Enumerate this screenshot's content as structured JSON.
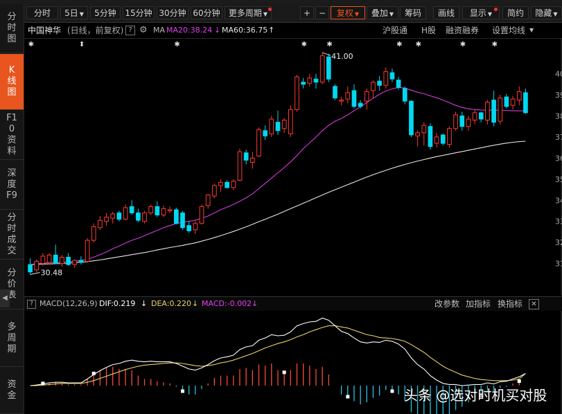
{
  "sidebar": {
    "items": [
      {
        "label": "分时图",
        "active": false
      },
      {
        "label": "K线图",
        "active": true
      },
      {
        "label": "F10资料",
        "active": false
      },
      {
        "label": "深度F9",
        "active": false
      },
      {
        "label": "分时成交",
        "active": false
      },
      {
        "label": "分价表",
        "active": false
      },
      {
        "label": "多周期",
        "active": false
      },
      {
        "label": "资金",
        "active": false
      }
    ]
  },
  "toolbar": {
    "periods": [
      "分时",
      "5日",
      "5分钟",
      "15分钟",
      "30分钟",
      "60分钟",
      "更多周期"
    ],
    "zoom_in": "+",
    "zoom_out": "−",
    "adjust": "复权",
    "overlay": "叠加",
    "chips": "筹码",
    "draw": "画线",
    "display": "显示",
    "simple": "简约",
    "hide": "隐藏"
  },
  "info": {
    "stock_name": "中国神华",
    "period_note": "(日线，前复权)",
    "help": "?",
    "ma_label": "MA",
    "ma20": "MA20:38.24",
    "ma60": "MA60:36.75",
    "links": [
      "沪股通",
      "H股",
      "融资融券",
      "设置均线"
    ]
  },
  "macd": {
    "title": "MACD(12,26,9)",
    "dif": "DIF:0.219",
    "dea": "DEA:0.220",
    "macd": "MACD:-0.002",
    "actions": [
      "改参数",
      "加指标",
      "换指标"
    ],
    "close": "✕"
  },
  "chart": {
    "price_high_label": "41.00",
    "price_low_label": "30.48",
    "right_axis": [
      "40",
      "39",
      "38",
      "37",
      "36",
      "35",
      "34",
      "33",
      "32",
      "31"
    ],
    "colors": {
      "up": "#ff3b30",
      "down": "#00d8f0",
      "ma20": "#d63be0",
      "ma60": "#e6e6e6",
      "dif": "#ffffff",
      "dea": "#e8d26a",
      "macd_pos": "#ff4a36",
      "macd_neg": "#22c8e8"
    }
  },
  "chart_data": {
    "type": "candlestick",
    "title": "中国神华",
    "ylabel": "",
    "ylim": [
      30.2,
      41.1
    ],
    "candles": [
      {
        "o": 30.95,
        "h": 31.25,
        "l": 30.48,
        "c": 30.6
      },
      {
        "o": 30.7,
        "h": 31.2,
        "l": 30.6,
        "c": 31.1
      },
      {
        "o": 31.0,
        "h": 31.5,
        "l": 30.9,
        "c": 31.35
      },
      {
        "o": 31.05,
        "h": 31.5,
        "l": 30.95,
        "c": 31.4
      },
      {
        "o": 31.4,
        "h": 31.9,
        "l": 31.3,
        "c": 31.0
      },
      {
        "o": 31.0,
        "h": 31.4,
        "l": 30.85,
        "c": 31.3
      },
      {
        "o": 31.3,
        "h": 31.5,
        "l": 30.9,
        "c": 30.95
      },
      {
        "o": 30.95,
        "h": 31.2,
        "l": 30.8,
        "c": 31.15
      },
      {
        "o": 31.15,
        "h": 31.35,
        "l": 30.95,
        "c": 31.05
      },
      {
        "o": 31.1,
        "h": 32.2,
        "l": 31.05,
        "c": 32.1
      },
      {
        "o": 32.1,
        "h": 32.9,
        "l": 32.0,
        "c": 32.75
      },
      {
        "o": 32.7,
        "h": 33.25,
        "l": 32.6,
        "c": 33.05
      },
      {
        "o": 33.0,
        "h": 33.4,
        "l": 32.8,
        "c": 33.2
      },
      {
        "o": 33.15,
        "h": 33.45,
        "l": 32.9,
        "c": 33.35
      },
      {
        "o": 33.4,
        "h": 33.5,
        "l": 33.0,
        "c": 33.1
      },
      {
        "o": 33.1,
        "h": 33.8,
        "l": 33.05,
        "c": 33.65
      },
      {
        "o": 33.7,
        "h": 34.0,
        "l": 33.3,
        "c": 33.4
      },
      {
        "o": 33.4,
        "h": 33.6,
        "l": 32.95,
        "c": 33.05
      },
      {
        "o": 33.0,
        "h": 33.5,
        "l": 32.9,
        "c": 33.4
      },
      {
        "o": 33.4,
        "h": 33.8,
        "l": 33.3,
        "c": 33.7
      },
      {
        "o": 33.7,
        "h": 33.95,
        "l": 33.2,
        "c": 33.3
      },
      {
        "o": 33.3,
        "h": 33.75,
        "l": 33.2,
        "c": 33.6
      },
      {
        "o": 33.5,
        "h": 33.7,
        "l": 33.4,
        "c": 33.55
      },
      {
        "o": 33.55,
        "h": 33.65,
        "l": 32.85,
        "c": 32.9
      },
      {
        "o": 33.4,
        "h": 33.5,
        "l": 32.6,
        "c": 32.7
      },
      {
        "o": 32.8,
        "h": 33.0,
        "l": 32.45,
        "c": 32.55
      },
      {
        "o": 32.6,
        "h": 33.0,
        "l": 32.4,
        "c": 32.9
      },
      {
        "o": 32.9,
        "h": 33.8,
        "l": 32.85,
        "c": 33.7
      },
      {
        "o": 33.75,
        "h": 34.3,
        "l": 33.6,
        "c": 34.25
      },
      {
        "o": 34.2,
        "h": 34.8,
        "l": 34.1,
        "c": 34.7
      },
      {
        "o": 34.7,
        "h": 35.0,
        "l": 34.4,
        "c": 34.85
      },
      {
        "o": 34.85,
        "h": 34.95,
        "l": 34.55,
        "c": 34.6
      },
      {
        "o": 34.6,
        "h": 35.0,
        "l": 34.5,
        "c": 34.9
      },
      {
        "o": 34.95,
        "h": 36.45,
        "l": 34.9,
        "c": 36.3
      },
      {
        "o": 36.25,
        "h": 36.4,
        "l": 35.7,
        "c": 35.9
      },
      {
        "o": 35.8,
        "h": 36.3,
        "l": 35.5,
        "c": 36.0
      },
      {
        "o": 36.1,
        "h": 37.45,
        "l": 36.05,
        "c": 37.35
      },
      {
        "o": 37.3,
        "h": 37.55,
        "l": 36.85,
        "c": 37.05
      },
      {
        "o": 37.15,
        "h": 38.0,
        "l": 37.0,
        "c": 37.85
      },
      {
        "o": 37.7,
        "h": 38.25,
        "l": 37.1,
        "c": 37.3
      },
      {
        "o": 37.4,
        "h": 37.9,
        "l": 37.2,
        "c": 37.8
      },
      {
        "o": 37.15,
        "h": 38.5,
        "l": 37.0,
        "c": 38.3
      },
      {
        "o": 38.3,
        "h": 39.95,
        "l": 38.2,
        "c": 39.85
      },
      {
        "o": 39.6,
        "h": 39.8,
        "l": 39.3,
        "c": 39.5
      },
      {
        "o": 39.55,
        "h": 40.0,
        "l": 39.4,
        "c": 39.8
      },
      {
        "o": 39.75,
        "h": 40.0,
        "l": 39.3,
        "c": 39.6
      },
      {
        "o": 39.6,
        "h": 41.0,
        "l": 39.5,
        "c": 40.85
      },
      {
        "o": 40.8,
        "h": 40.95,
        "l": 39.6,
        "c": 39.75
      },
      {
        "o": 39.4,
        "h": 39.5,
        "l": 38.75,
        "c": 38.85
      },
      {
        "o": 38.7,
        "h": 38.9,
        "l": 38.5,
        "c": 38.75
      },
      {
        "o": 38.8,
        "h": 39.4,
        "l": 38.6,
        "c": 39.1
      },
      {
        "o": 39.2,
        "h": 39.5,
        "l": 38.35,
        "c": 38.45
      },
      {
        "o": 38.6,
        "h": 38.75,
        "l": 38.35,
        "c": 38.45
      },
      {
        "o": 38.7,
        "h": 39.3,
        "l": 38.3,
        "c": 39.15
      },
      {
        "o": 39.2,
        "h": 39.7,
        "l": 38.85,
        "c": 39.6
      },
      {
        "o": 39.65,
        "h": 39.9,
        "l": 39.2,
        "c": 39.45
      },
      {
        "o": 39.45,
        "h": 40.3,
        "l": 39.3,
        "c": 40.1
      },
      {
        "o": 40.05,
        "h": 40.25,
        "l": 39.6,
        "c": 39.75
      },
      {
        "o": 39.7,
        "h": 39.85,
        "l": 39.25,
        "c": 39.35
      },
      {
        "o": 39.3,
        "h": 39.4,
        "l": 38.55,
        "c": 38.7
      },
      {
        "o": 38.7,
        "h": 38.75,
        "l": 37.0,
        "c": 37.1
      },
      {
        "o": 37.05,
        "h": 37.3,
        "l": 36.55,
        "c": 37.2
      },
      {
        "o": 37.2,
        "h": 37.7,
        "l": 36.6,
        "c": 37.55
      },
      {
        "o": 37.5,
        "h": 37.65,
        "l": 36.4,
        "c": 36.55
      },
      {
        "o": 36.7,
        "h": 37.2,
        "l": 36.5,
        "c": 37.0
      },
      {
        "o": 37.1,
        "h": 37.15,
        "l": 36.6,
        "c": 36.7
      },
      {
        "o": 36.65,
        "h": 37.5,
        "l": 36.5,
        "c": 37.4
      },
      {
        "o": 37.4,
        "h": 38.2,
        "l": 37.3,
        "c": 38.05
      },
      {
        "o": 38.0,
        "h": 38.2,
        "l": 37.3,
        "c": 37.5
      },
      {
        "o": 37.5,
        "h": 38.0,
        "l": 37.3,
        "c": 37.85
      },
      {
        "o": 37.8,
        "h": 38.3,
        "l": 37.6,
        "c": 38.15
      },
      {
        "o": 38.15,
        "h": 38.2,
        "l": 37.7,
        "c": 37.85
      },
      {
        "o": 37.8,
        "h": 38.75,
        "l": 37.6,
        "c": 38.65
      },
      {
        "o": 38.75,
        "h": 39.2,
        "l": 37.5,
        "c": 37.7
      },
      {
        "o": 37.75,
        "h": 39.0,
        "l": 37.6,
        "c": 38.85
      },
      {
        "o": 38.9,
        "h": 39.05,
        "l": 38.35,
        "c": 38.45
      },
      {
        "o": 38.5,
        "h": 38.95,
        "l": 38.3,
        "c": 38.8
      },
      {
        "o": 38.75,
        "h": 39.4,
        "l": 38.5,
        "c": 39.15
      },
      {
        "o": 39.1,
        "h": 39.3,
        "l": 38.1,
        "c": 38.15
      }
    ],
    "ma20": [
      30.95,
      31.0,
      31.0,
      31.05,
      31.05,
      31.05,
      31.1,
      31.1,
      31.15,
      31.2,
      31.3,
      31.42,
      31.55,
      31.7,
      31.83,
      31.97,
      32.1,
      32.2,
      32.32,
      32.45,
      32.57,
      32.7,
      32.8,
      32.9,
      32.95,
      33.0,
      33.05,
      33.15,
      33.25,
      33.4,
      33.55,
      33.67,
      33.8,
      33.95,
      34.12,
      34.3,
      34.55,
      34.8,
      35.05,
      35.3,
      35.55,
      35.82,
      36.12,
      36.45,
      36.72,
      37.0,
      37.3,
      37.55,
      37.75,
      37.88,
      38.05,
      38.25,
      38.43,
      38.63,
      38.83,
      39.03,
      39.18,
      39.28,
      39.35,
      39.32,
      39.22,
      39.12,
      39.05,
      38.95,
      38.86,
      38.75,
      38.63,
      38.5,
      38.4,
      38.34,
      38.3,
      38.28,
      38.27,
      38.27,
      38.27,
      38.26,
      38.24,
      38.24,
      38.24
    ],
    "ma60": [
      30.95,
      30.96,
      30.97,
      30.98,
      30.99,
      31.0,
      31.02,
      31.04,
      31.06,
      31.09,
      31.13,
      31.17,
      31.22,
      31.27,
      31.32,
      31.37,
      31.42,
      31.47,
      31.52,
      31.58,
      31.64,
      31.7,
      31.76,
      31.81,
      31.86,
      31.92,
      31.98,
      32.06,
      32.14,
      32.23,
      32.32,
      32.42,
      32.52,
      32.63,
      32.74,
      32.86,
      32.98,
      33.1,
      33.22,
      33.34,
      33.47,
      33.6,
      33.73,
      33.86,
      33.99,
      34.12,
      34.25,
      34.38,
      34.5,
      34.62,
      34.74,
      34.86,
      34.98,
      35.1,
      35.21,
      35.32,
      35.42,
      35.52,
      35.61,
      35.7,
      35.78,
      35.86,
      35.93,
      36.0,
      36.07,
      36.13,
      36.19,
      36.25,
      36.31,
      36.37,
      36.43,
      36.49,
      36.55,
      36.61,
      36.66,
      36.71,
      36.75,
      36.78,
      36.8
    ],
    "macd_dif": [
      0.0,
      0.01,
      0.03,
      0.05,
      0.06,
      0.06,
      0.05,
      0.05,
      0.05,
      0.12,
      0.2,
      0.27,
      0.33,
      0.38,
      0.4,
      0.44,
      0.46,
      0.44,
      0.43,
      0.44,
      0.43,
      0.43,
      0.43,
      0.4,
      0.35,
      0.3,
      0.28,
      0.32,
      0.38,
      0.45,
      0.5,
      0.52,
      0.55,
      0.65,
      0.7,
      0.72,
      0.82,
      0.86,
      0.92,
      0.9,
      0.91,
      0.97,
      1.08,
      1.12,
      1.15,
      1.16,
      1.22,
      1.18,
      1.08,
      0.98,
      0.94,
      0.86,
      0.79,
      0.77,
      0.79,
      0.78,
      0.82,
      0.8,
      0.75,
      0.66,
      0.5,
      0.38,
      0.3,
      0.18,
      0.1,
      0.04,
      0.02,
      0.02,
      0.0,
      0.01,
      0.02,
      0.02,
      0.05,
      0.03,
      0.07,
      0.08,
      0.12,
      0.16,
      0.219
    ],
    "macd_dea": [
      0.0,
      0.0,
      0.01,
      0.02,
      0.03,
      0.04,
      0.04,
      0.04,
      0.04,
      0.06,
      0.09,
      0.13,
      0.17,
      0.21,
      0.25,
      0.29,
      0.32,
      0.35,
      0.37,
      0.38,
      0.39,
      0.4,
      0.41,
      0.41,
      0.4,
      0.38,
      0.36,
      0.35,
      0.36,
      0.38,
      0.41,
      0.43,
      0.46,
      0.5,
      0.54,
      0.58,
      0.63,
      0.68,
      0.72,
      0.76,
      0.79,
      0.83,
      0.88,
      0.92,
      0.97,
      1.01,
      1.05,
      1.08,
      1.08,
      1.06,
      1.04,
      1.0,
      0.96,
      0.92,
      0.9,
      0.87,
      0.86,
      0.85,
      0.83,
      0.8,
      0.74,
      0.67,
      0.6,
      0.51,
      0.43,
      0.35,
      0.29,
      0.24,
      0.19,
      0.16,
      0.13,
      0.11,
      0.1,
      0.09,
      0.09,
      0.09,
      0.1,
      0.12,
      0.22
    ]
  },
  "watermark": "头条 @选对时机买对股"
}
